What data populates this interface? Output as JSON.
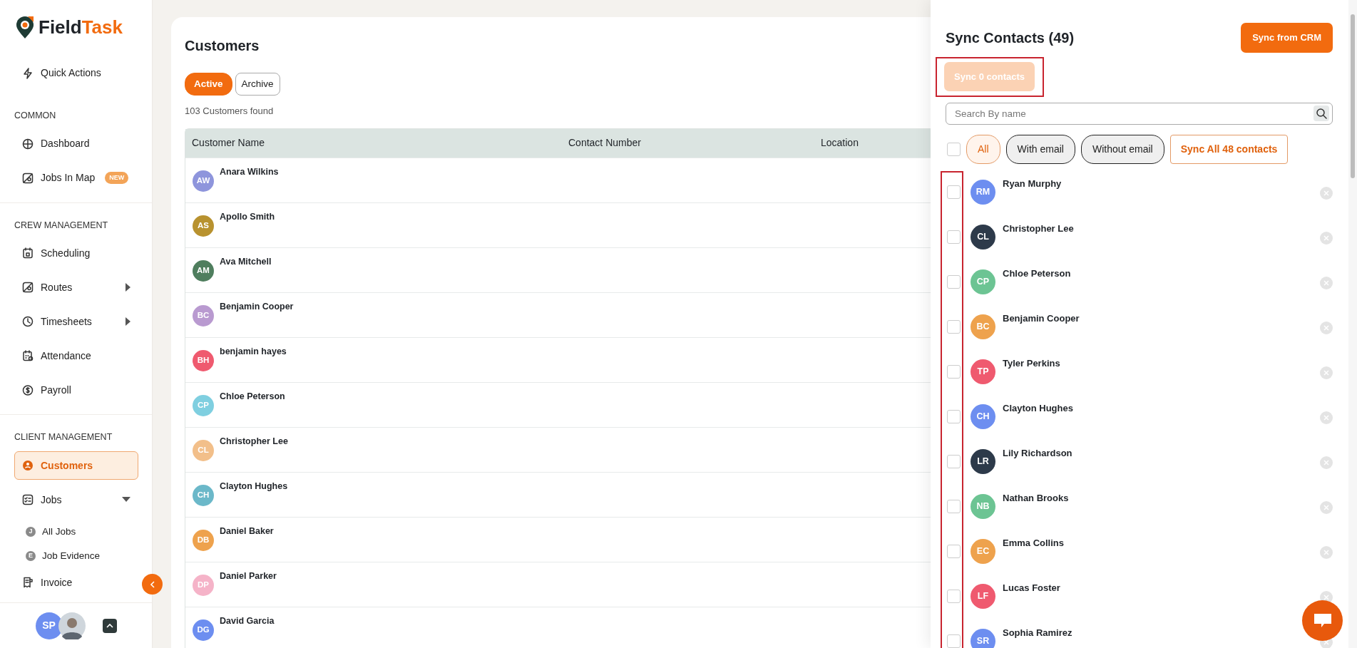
{
  "sidebar": {
    "logo": {
      "first": "Field",
      "second": "Task"
    },
    "quick_action": {
      "label": "Quick Actions"
    },
    "sections": [
      {
        "heading": "COMMON",
        "items": [
          {
            "label": "Dashboard",
            "selected": false
          },
          {
            "label": "Jobs In Map",
            "selected": false,
            "badge": "NEW"
          }
        ]
      },
      {
        "heading": "CREW MANAGEMENT",
        "items": [
          {
            "label": "Scheduling",
            "selected": false
          },
          {
            "label": "Routes",
            "selected": false,
            "expanded": false
          },
          {
            "label": "Timesheets",
            "selected": false,
            "expanded": false
          },
          {
            "label": "Attendance",
            "selected": false
          },
          {
            "label": "Payroll",
            "selected": false
          }
        ]
      },
      {
        "heading": "CLIENT MANAGEMENT",
        "items": [
          {
            "label": "Customers",
            "selected": true
          },
          {
            "label": "Jobs",
            "selected": false,
            "expanded": true,
            "children": [
              {
                "label": "All Jobs",
                "initial": "J"
              },
              {
                "label": "Job Evidence",
                "initial": "E"
              }
            ]
          },
          {
            "label": "Invoice",
            "selected": false
          }
        ]
      }
    ],
    "user": {
      "initials": "SP"
    }
  },
  "main": {
    "title": "Customers",
    "tabs": [
      {
        "label": "Active",
        "selected": true
      },
      {
        "label": "Archive",
        "selected": false
      }
    ],
    "count": "103 Customers found",
    "table": {
      "columns": [
        "Customer Name",
        "Contact Number",
        "Location"
      ],
      "rows": [
        {
          "initials": "AW",
          "name": "Anara Wilkins",
          "color": "#8e95dc"
        },
        {
          "initials": "AS",
          "name": "Apollo Smith",
          "color": "#b8922f"
        },
        {
          "initials": "AM",
          "name": "Ava Mitchell",
          "color": "#4f7e5e"
        },
        {
          "initials": "BC",
          "name": "Benjamin Cooper",
          "color": "#b99ad0"
        },
        {
          "initials": "BH",
          "name": "benjamin hayes",
          "color": "#ef5a6f"
        },
        {
          "initials": "CP",
          "name": "Chloe Peterson",
          "color": "#7fcfe0"
        },
        {
          "initials": "CL",
          "name": "Christopher Lee",
          "color": "#f2bf8a"
        },
        {
          "initials": "CH",
          "name": "Clayton Hughes",
          "color": "#6bb8c9"
        },
        {
          "initials": "DB",
          "name": "Daniel Baker",
          "color": "#eea24d"
        },
        {
          "initials": "DP",
          "name": "Daniel Parker",
          "color": "#f5b3c8"
        },
        {
          "initials": "DG",
          "name": "David Garcia",
          "color": "#6d8ef0"
        }
      ]
    }
  },
  "panel": {
    "title": "Sync Contacts (49)",
    "crm_button": "Sync from CRM",
    "sync_button": {
      "label": "Sync 0 contacts",
      "disabled": true,
      "highlighted": true
    },
    "search": {
      "placeholder": "Search By name"
    },
    "select_all": {
      "checked": false
    },
    "filters": [
      {
        "label": "All",
        "selected": true
      },
      {
        "label": "With email",
        "selected": false
      },
      {
        "label": "Without email",
        "selected": false
      }
    ],
    "sync_all_button": "Sync All 48 contacts",
    "checkbox_column_highlighted": true,
    "contacts": [
      {
        "initials": "RM",
        "name": "Ryan Murphy",
        "color": "#6d8ef0",
        "checked": false
      },
      {
        "initials": "CL",
        "name": "Christopher Lee",
        "color": "#2d3a4a",
        "checked": false
      },
      {
        "initials": "CP",
        "name": "Chloe Peterson",
        "color": "#6cc493",
        "checked": false
      },
      {
        "initials": "BC",
        "name": "Benjamin Cooper",
        "color": "#eea24d",
        "checked": false
      },
      {
        "initials": "TP",
        "name": "Tyler Perkins",
        "color": "#ef5a6f",
        "checked": false
      },
      {
        "initials": "CH",
        "name": "Clayton Hughes",
        "color": "#6d8ef0",
        "checked": false
      },
      {
        "initials": "LR",
        "name": "Lily Richardson",
        "color": "#2d3a4a",
        "checked": false
      },
      {
        "initials": "NB",
        "name": "Nathan Brooks",
        "color": "#6cc493",
        "checked": false
      },
      {
        "initials": "EC",
        "name": "Emma Collins",
        "color": "#eea24d",
        "checked": false
      },
      {
        "initials": "LF",
        "name": "Lucas Foster",
        "color": "#ef5a6f",
        "checked": false
      },
      {
        "initials": "SR",
        "name": "Sophia Ramirez",
        "color": "#6d8ef0",
        "checked": false
      }
    ]
  }
}
